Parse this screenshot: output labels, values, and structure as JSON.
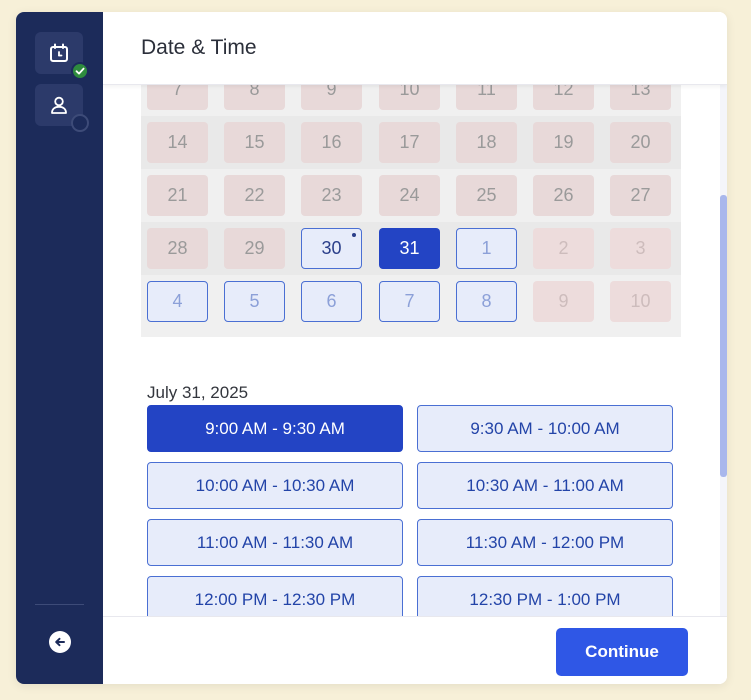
{
  "header": {
    "title": "Date & Time"
  },
  "sidebar": {
    "steps": [
      {
        "name": "date-time-step",
        "icon": "calendar-clock-icon",
        "status": "complete"
      },
      {
        "name": "details-step",
        "icon": "person-icon",
        "status": "pending"
      }
    ],
    "back_icon": "arrow-left-icon"
  },
  "calendar": {
    "weeks": [
      [
        {
          "day": "7",
          "state": "disabled"
        },
        {
          "day": "8",
          "state": "disabled"
        },
        {
          "day": "9",
          "state": "disabled"
        },
        {
          "day": "10",
          "state": "disabled"
        },
        {
          "day": "11",
          "state": "disabled"
        },
        {
          "day": "12",
          "state": "disabled"
        },
        {
          "day": "13",
          "state": "disabled"
        }
      ],
      [
        {
          "day": "14",
          "state": "disabled"
        },
        {
          "day": "15",
          "state": "disabled"
        },
        {
          "day": "16",
          "state": "disabled"
        },
        {
          "day": "17",
          "state": "disabled"
        },
        {
          "day": "18",
          "state": "disabled"
        },
        {
          "day": "19",
          "state": "disabled"
        },
        {
          "day": "20",
          "state": "disabled"
        }
      ],
      [
        {
          "day": "21",
          "state": "disabled"
        },
        {
          "day": "22",
          "state": "disabled"
        },
        {
          "day": "23",
          "state": "disabled"
        },
        {
          "day": "24",
          "state": "disabled"
        },
        {
          "day": "25",
          "state": "disabled"
        },
        {
          "day": "26",
          "state": "disabled"
        },
        {
          "day": "27",
          "state": "disabled"
        }
      ],
      [
        {
          "day": "28",
          "state": "disabled"
        },
        {
          "day": "29",
          "state": "disabled"
        },
        {
          "day": "30",
          "state": "available",
          "today": true
        },
        {
          "day": "31",
          "state": "selected"
        },
        {
          "day": "1",
          "state": "available-next"
        },
        {
          "day": "2",
          "state": "faded"
        },
        {
          "day": "3",
          "state": "faded"
        }
      ],
      [
        {
          "day": "4",
          "state": "available-next"
        },
        {
          "day": "5",
          "state": "available-next"
        },
        {
          "day": "6",
          "state": "available-next"
        },
        {
          "day": "7",
          "state": "available-next"
        },
        {
          "day": "8",
          "state": "available-next"
        },
        {
          "day": "9",
          "state": "faded"
        },
        {
          "day": "10",
          "state": "faded"
        }
      ]
    ]
  },
  "selected_date": "July 31, 2025",
  "time_slots": [
    {
      "label": "9:00 AM - 9:30 AM",
      "selected": true
    },
    {
      "label": "9:30 AM - 10:00 AM",
      "selected": false
    },
    {
      "label": "10:00 AM - 10:30 AM",
      "selected": false
    },
    {
      "label": "10:30 AM - 11:00 AM",
      "selected": false
    },
    {
      "label": "11:00 AM - 11:30 AM",
      "selected": false
    },
    {
      "label": "11:30 AM - 12:00 PM",
      "selected": false
    },
    {
      "label": "12:00 PM - 12:30 PM",
      "selected": false
    },
    {
      "label": "12:30 PM - 1:00 PM",
      "selected": false
    }
  ],
  "footer": {
    "continue_label": "Continue"
  },
  "colors": {
    "sidebar": "#1c2b5a",
    "accent": "#2344c4",
    "button": "#2f57e6",
    "complete": "#2e8b3e"
  }
}
